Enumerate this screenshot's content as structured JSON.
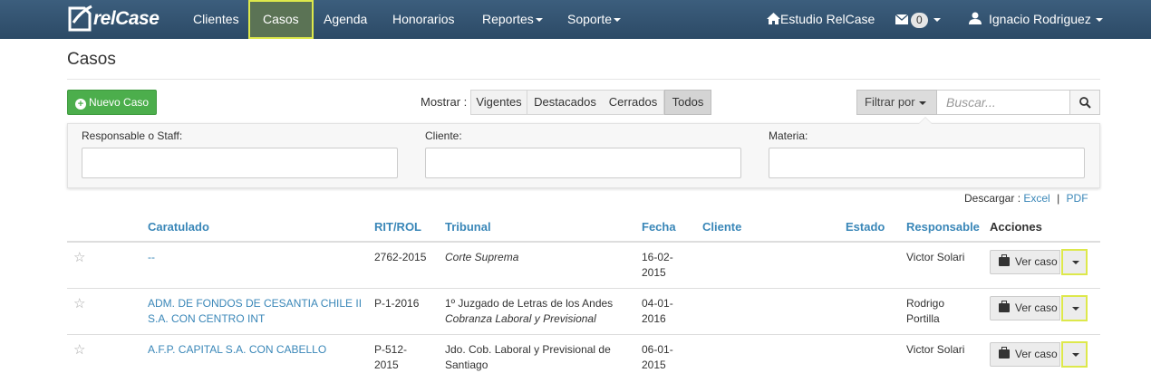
{
  "brand": {
    "logo_text": "relCase"
  },
  "nav": {
    "items": [
      "Clientes",
      "Casos",
      "Agenda",
      "Honorarios",
      "Reportes",
      "Soporte"
    ],
    "active": "Casos",
    "studio": "Estudio RelCase",
    "messages_count": "0",
    "user": "Ignacio Rodriguez"
  },
  "page": {
    "title": "Casos"
  },
  "toolbar": {
    "new_case": "Nuevo Caso",
    "show_label": "Mostrar :",
    "filters": [
      "Vigentes",
      "Destacados",
      "Cerrados",
      "Todos"
    ],
    "selected_filter": "Todos",
    "filter_by": "Filtrar por",
    "search_placeholder": "Buscar..."
  },
  "filter_panel": {
    "responsable_label": "Responsable o Staff:",
    "cliente_label": "Cliente:",
    "materia_label": "Materia:"
  },
  "download": {
    "label": "Descargar :",
    "excel": "Excel",
    "sep": "|",
    "pdf": "PDF"
  },
  "table": {
    "headers": [
      "Caratulado",
      "RIT/ROL",
      "Tribunal",
      "Fecha",
      "Cliente",
      "Estado",
      "Responsable",
      "Acciones"
    ],
    "rows": [
      {
        "caratulado": [
          "--"
        ],
        "rit": [
          "2762-2015"
        ],
        "tribunal": [
          "Corte Suprema"
        ],
        "tribunal_italic": true,
        "fecha": [
          "16-02-",
          "2015"
        ],
        "cliente": "",
        "estado": "",
        "responsable": [
          "Victor Solari"
        ]
      },
      {
        "caratulado": [
          "ADM. DE FONDOS DE CESANTIA CHILE II",
          "S.A. CON CENTRO INT"
        ],
        "rit": [
          "P-1-2016"
        ],
        "tribunal": [
          "1º Juzgado de Letras de los Andes",
          "Cobranza Laboral y Previsional"
        ],
        "fecha": [
          "04-01-",
          "2016"
        ],
        "cliente": "",
        "estado": "",
        "responsable": [
          "Rodrigo",
          "Portilla"
        ]
      },
      {
        "caratulado": [
          "A.F.P. CAPITAL S.A. CON CABELLO"
        ],
        "rit": [
          "P-512-",
          "2015"
        ],
        "tribunal": [
          "Jdo. Cob. Laboral y Previsional de",
          "Santiago"
        ],
        "fecha": [
          "06-01-",
          "2015"
        ],
        "cliente": "",
        "estado": "",
        "responsable": [
          "Victor Solari"
        ]
      }
    ],
    "action_label": "Ver caso"
  },
  "colors": {
    "topbar": "#34536f",
    "accent": "#3a87b8",
    "success": "#4cae4c",
    "highlight": "#dde84b"
  }
}
